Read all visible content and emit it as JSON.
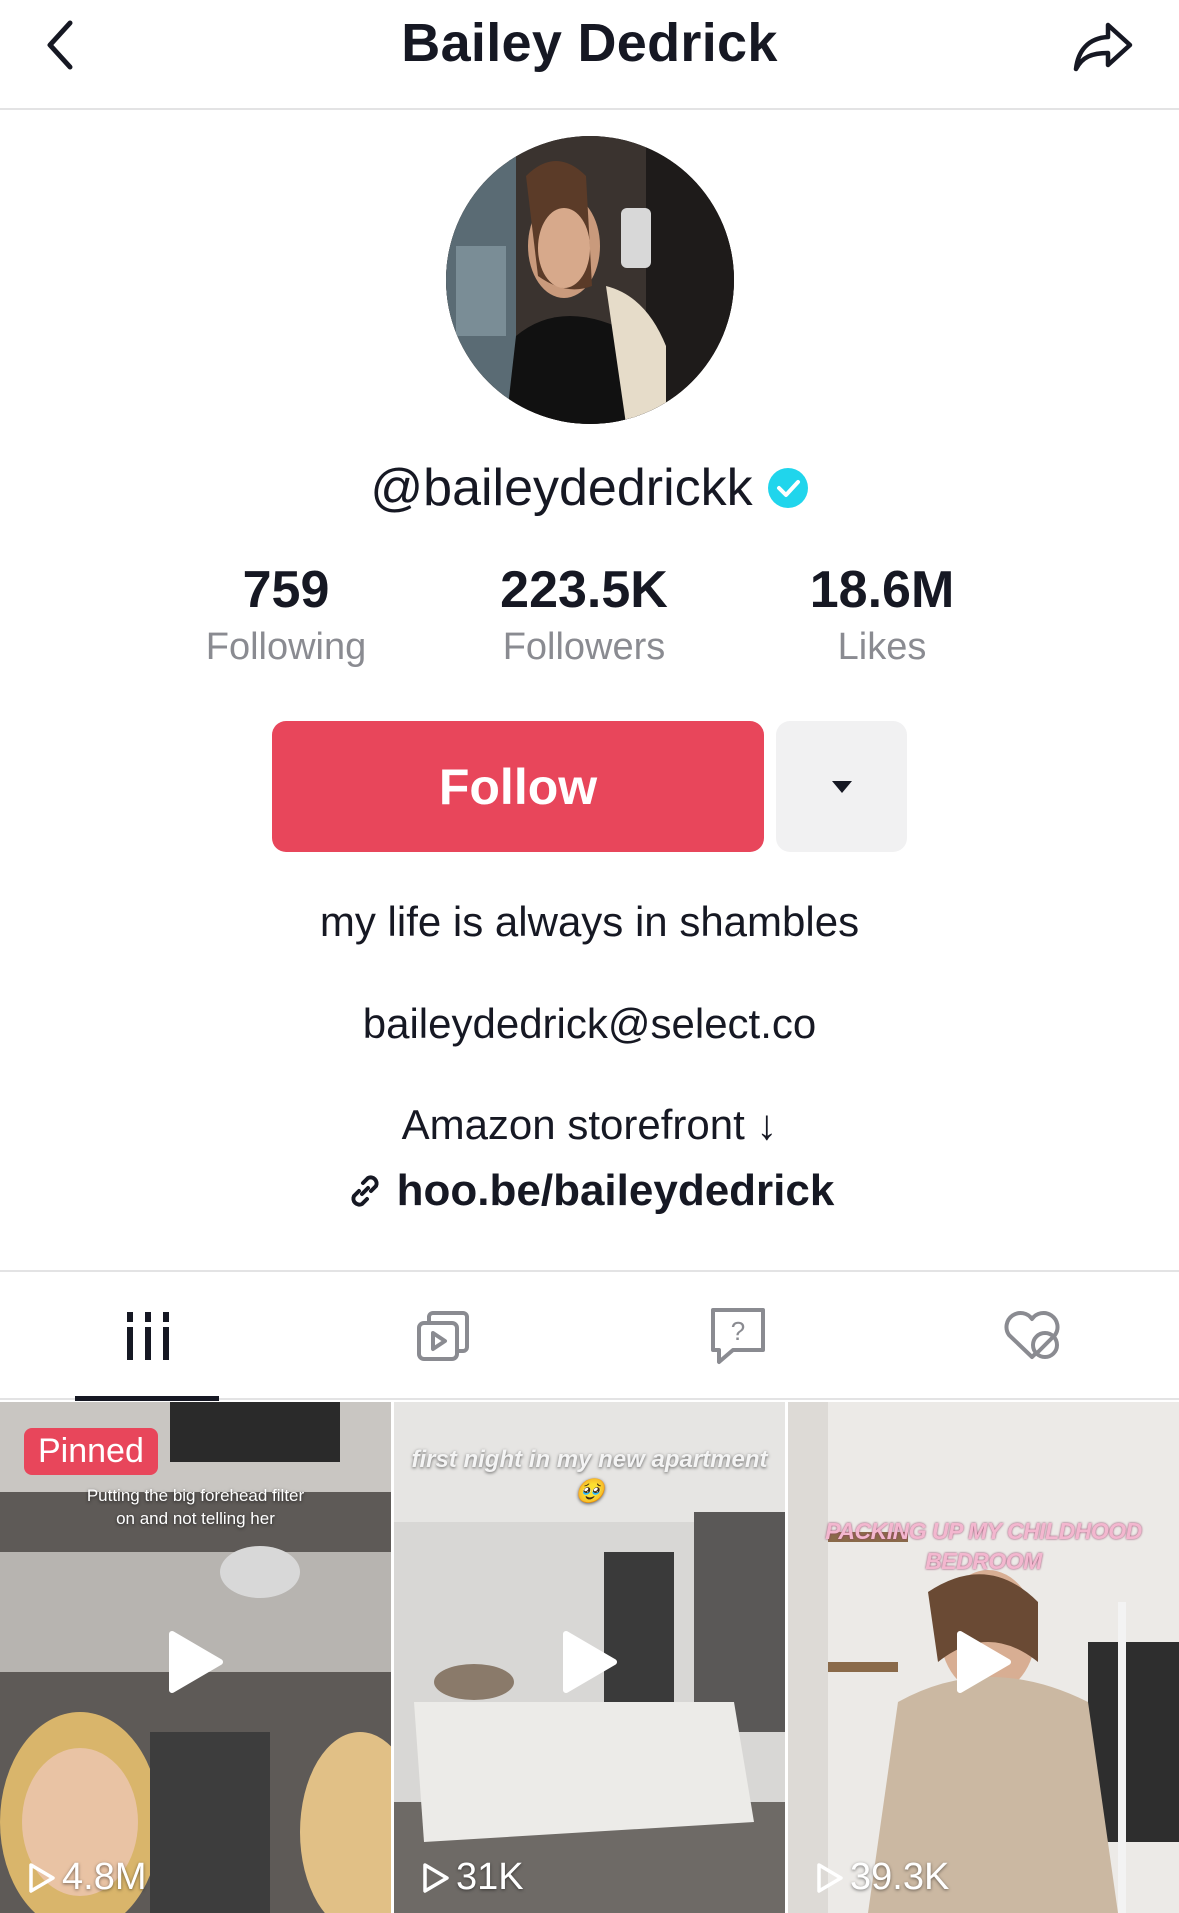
{
  "header": {
    "title": "Bailey Dedrick",
    "back_icon": "chevron-left-icon",
    "share_icon": "share-arrow-icon"
  },
  "profile": {
    "handle": "@baileydedrickk",
    "verified_icon": "verified-badge-icon",
    "verified_color": "#20d5ec"
  },
  "stats": [
    {
      "value": "759",
      "label": "Following"
    },
    {
      "value": "223.5K",
      "label": "Followers"
    },
    {
      "value": "18.6M",
      "label": "Likes"
    }
  ],
  "actions": {
    "follow_label": "Follow",
    "follow_color": "#e8465b",
    "more_icon": "caret-down-icon"
  },
  "bio": {
    "line1": "my life is always in shambles",
    "line2": "baileydedrick@select.co",
    "line3": "Amazon storefront ↓",
    "link_icon": "link-icon",
    "link": "hoo.be/baileydedrick"
  },
  "tabs": [
    {
      "icon": "videos-grid-icon",
      "active": true
    },
    {
      "icon": "reposts-icon",
      "active": false
    },
    {
      "icon": "question-bubble-icon",
      "active": false
    },
    {
      "icon": "liked-hidden-icon",
      "active": false
    }
  ],
  "videos": [
    {
      "badge": "Pinned",
      "caption": "Putting the big forehead filter on and not telling her",
      "views": "4.8M"
    },
    {
      "badge": "",
      "caption": "first night in my new apartment 🥹",
      "views": "31K"
    },
    {
      "badge": "",
      "caption": "PACKING UP MY CHILDHOOD BEDROOM",
      "views": "39.3K"
    }
  ]
}
